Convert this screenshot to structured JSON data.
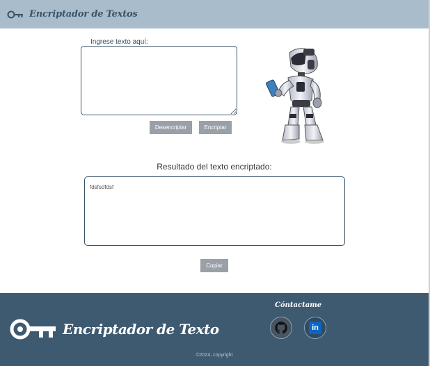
{
  "header": {
    "title": "Encriptador de Textos",
    "icon": "key-icon"
  },
  "input": {
    "label": "Ingrese texto aquí:",
    "value": ""
  },
  "buttons": {
    "decrypt": "Desencriptar",
    "encrypt": "Encriptar",
    "copy": "Copiar"
  },
  "result": {
    "title": "Resultado del texto encriptado:",
    "value": "fdsfsdfdsf"
  },
  "footer": {
    "brand": "Encriptador de Texto",
    "contact_title": "Cóntactame",
    "copyright": "©2024, copyright",
    "social": [
      {
        "icon": "github-icon"
      },
      {
        "icon": "linkedin-icon",
        "text": "in"
      }
    ]
  },
  "colors": {
    "header_bg": "#a9bccb",
    "footer_bg": "#3e5a70",
    "button_bg": "#9aa0a8",
    "accent": "#3a5468"
  }
}
